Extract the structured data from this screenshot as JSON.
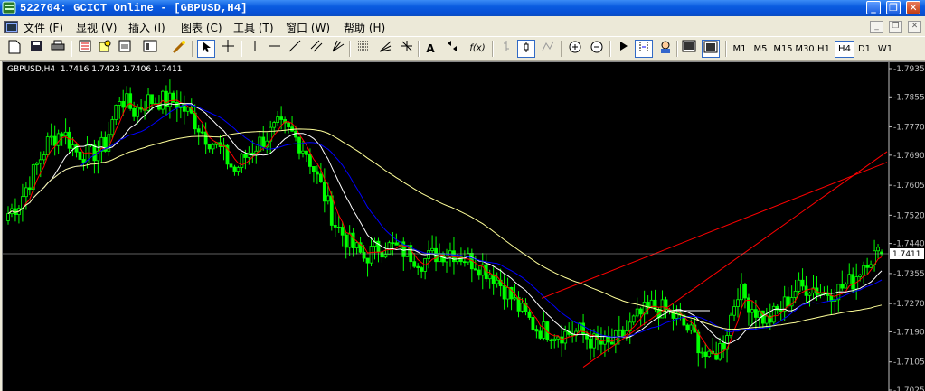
{
  "window": {
    "title": "522704: GCICT Online - [GBPUSD,H4]",
    "buttons": [
      "minimize",
      "restore",
      "close"
    ]
  },
  "menu": {
    "items": [
      "文件 (F)",
      "显视 (V)",
      "插入 (I)",
      "图表 (C)",
      "工具 (T)",
      "窗口 (W)",
      "帮助 (H)"
    ]
  },
  "toolbar": {
    "text_tool_label": "A",
    "timeframes": [
      "M1",
      "M5",
      "M15",
      "M30",
      "H1",
      "H4",
      "D1",
      "W1"
    ],
    "active_timeframe": "H4"
  },
  "chart": {
    "header": "GBPUSD,H4  1.7416 1.7423 1.7406 1.7411",
    "current_price": "1.7411",
    "colors": {
      "background": "#000000",
      "bull": "#00ff00",
      "bear": "#00ff00",
      "ma_fast": "#ff0000",
      "ma_mid": "#ffffff",
      "ma_slow": "#0000ff",
      "ma_long": "#ffff99",
      "trendline": "#ff0000",
      "price_line": "#c0c0c0"
    }
  },
  "chart_data": {
    "type": "candlestick",
    "symbol": "GBPUSD",
    "timeframe": "H4",
    "y_ticks": [
      1.7935,
      1.7855,
      1.777,
      1.769,
      1.7605,
      1.752,
      1.744,
      1.7355,
      1.727,
      1.719,
      1.7105,
      1.7025
    ],
    "ylim": [
      1.7025,
      1.7935
    ],
    "last": {
      "open": 1.7416,
      "high": 1.7423,
      "low": 1.7406,
      "close": 1.7411
    },
    "closes": [
      1.7555,
      1.764,
      1.7725,
      1.776,
      1.77,
      1.769,
      1.772,
      1.7855,
      1.7815,
      1.7845,
      1.7845,
      1.784,
      1.78,
      1.7745,
      1.7705,
      1.7645,
      1.77,
      1.7735,
      1.777,
      1.775,
      1.77,
      1.76,
      1.7495,
      1.744,
      1.74,
      1.743,
      1.743,
      1.7415,
      1.739,
      1.741,
      1.742,
      1.74,
      1.738,
      1.735,
      1.73,
      1.7245,
      1.72,
      1.719,
      1.7185,
      1.719,
      1.716,
      1.715,
      1.718,
      1.723,
      1.726,
      1.725,
      1.722,
      1.7175,
      1.7105,
      1.716,
      1.731,
      1.726,
      1.722,
      1.7255,
      1.731,
      1.732,
      1.73,
      1.731,
      1.7335,
      1.74,
      1.7411
    ]
  }
}
